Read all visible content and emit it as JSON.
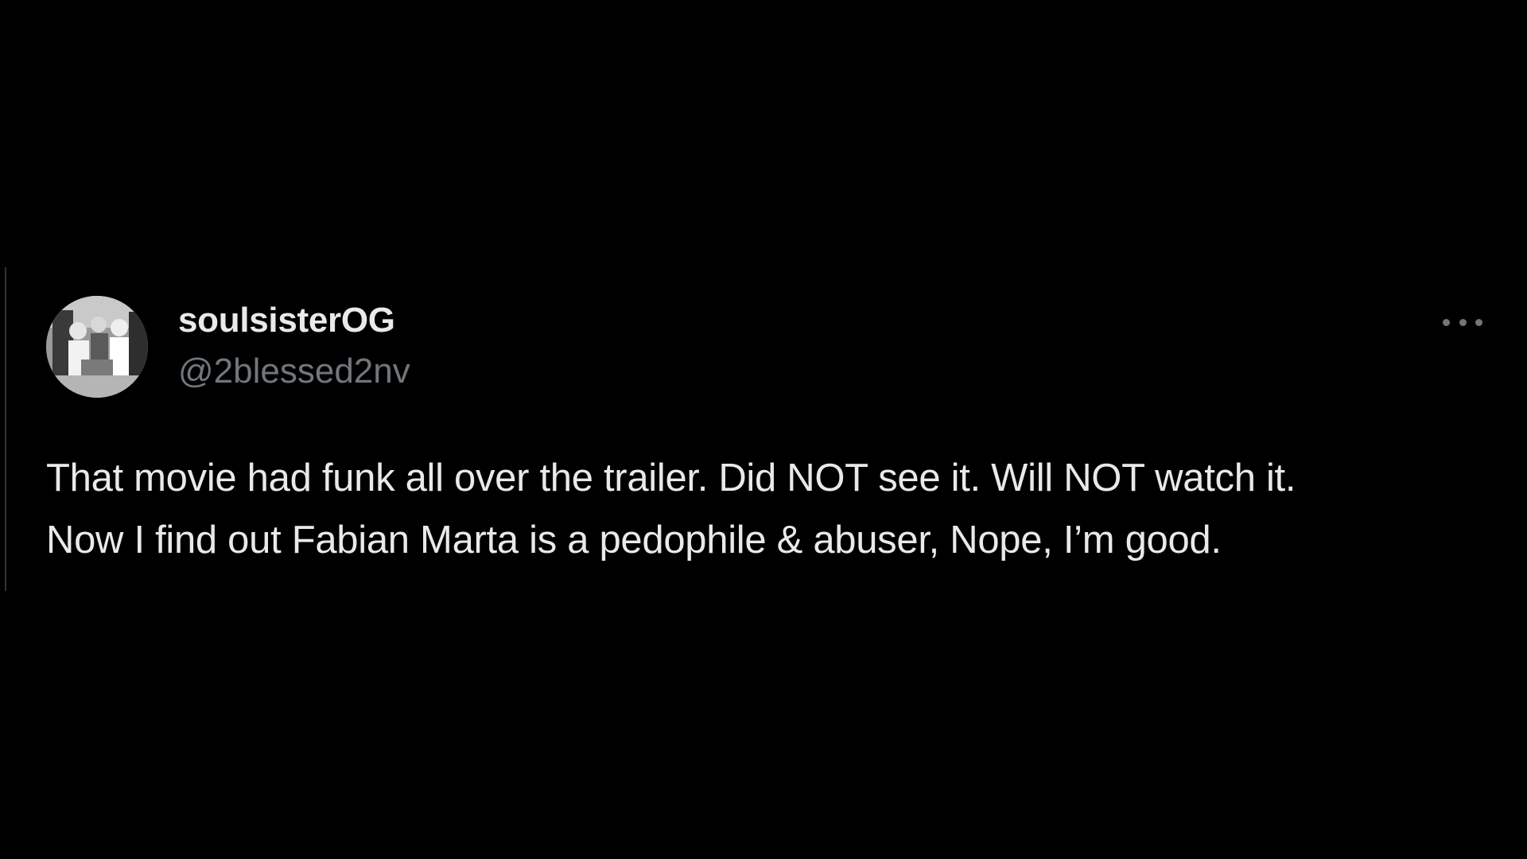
{
  "tweet": {
    "display_name": "soulsisterOG",
    "handle": "@2blessed2nv",
    "avatar_icon": "profile-photo-avatar",
    "more_icon": "more-options-icon",
    "text_lines": [
      "That movie had funk all over the trailer. Did NOT see it. Will NOT watch it.",
      "Now I find out Fabian Marta is a pedophile & abuser, Nope, I’m good."
    ]
  },
  "colors": {
    "background": "#000000",
    "primary_text": "#e7e9ea",
    "secondary_text": "#71767b"
  }
}
